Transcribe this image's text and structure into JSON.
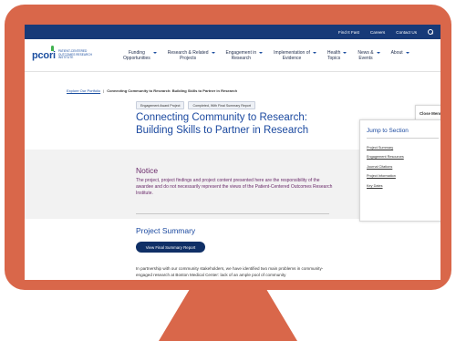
{
  "utility_bar": {
    "links": [
      "Find It Fast",
      "Careers",
      "Contact Us"
    ]
  },
  "logo": {
    "mark": "pcori",
    "text": "PATIENT-CENTERED OUTCOMES RESEARCH INSTITUTE"
  },
  "nav": {
    "items": [
      {
        "line1": "Funding",
        "line2": "Opportunities"
      },
      {
        "line1": "Research & Related",
        "line2": "Projects"
      },
      {
        "line1": "Engagement in",
        "line2": "Research"
      },
      {
        "line1": "Implementation of",
        "line2": "Evidence"
      },
      {
        "line1": "Health",
        "line2": "Topics"
      },
      {
        "line1": "News &",
        "line2": "Events"
      },
      {
        "line1": "About",
        "line2": ""
      }
    ]
  },
  "breadcrumb": {
    "parent": "Explore Our Portfolio",
    "separator": "|",
    "current": "Connecting Community to Research: Building Skills to Partner in Research"
  },
  "tags": [
    "Engagement Award Project",
    "Completed, With Final Summary Report"
  ],
  "page_title": "Connecting Community to Research: Building Skills to Partner in Research",
  "notice": {
    "title": "Notice",
    "body": "The project, project findings and project content presented here are the responsibility of the awardee and do not necessarily represent the views of the Patient-Centered Outcomes Research Institute."
  },
  "summary": {
    "title": "Project Summary",
    "button": "View Final Summary Report",
    "body": "In partnership with our community stakeholders, we have identified two main problems in community-engaged research at Boston Medical Center: lack of an ample pool of community"
  },
  "side_menu": {
    "close_label": "Close Menu",
    "jump_title": "Jump to Section",
    "links": [
      "Project Summary",
      "Engagement Resources",
      "Journal Citations",
      "Project Information",
      "Key Dates"
    ]
  },
  "colors": {
    "monitor": "#d9674a",
    "navy": "#173a78",
    "title_blue": "#1c4aa0",
    "notice_purple": "#6a2a6a"
  }
}
